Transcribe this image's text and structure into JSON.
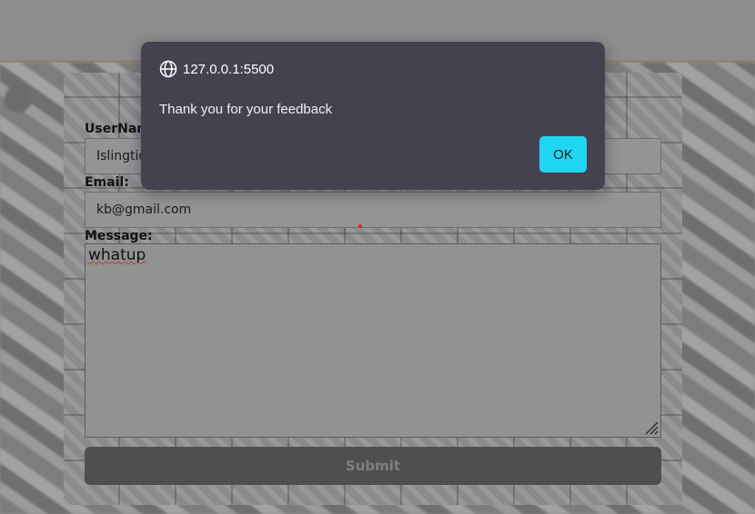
{
  "dialog": {
    "origin": "127.0.0.1:5500",
    "message": "Thank you for your feedback",
    "ok_label": "OK",
    "origin_icon": "globe-icon",
    "accent": "#1fd6f2"
  },
  "form": {
    "username_label": "UserName:",
    "username_value": "Islingtion",
    "email_label": "Email:",
    "email_value": "kb@gmail.com",
    "message_label": "Message:",
    "message_value": "whatup",
    "submit_label": "Submit"
  }
}
